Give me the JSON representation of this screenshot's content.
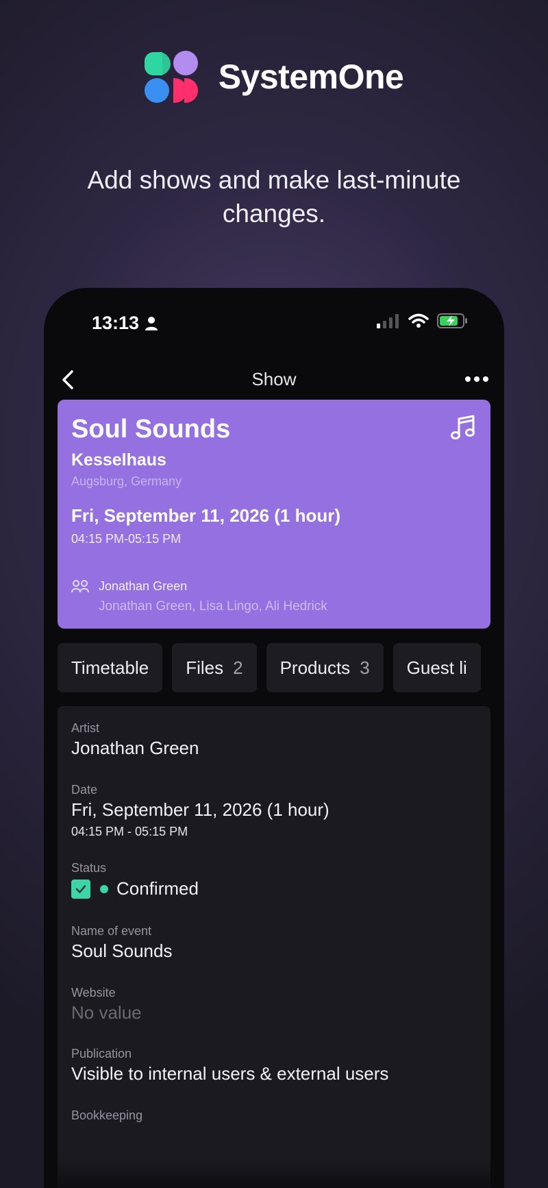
{
  "brand": {
    "name": "SystemOne"
  },
  "tagline": "Add shows and make last-minute changes.",
  "status_bar": {
    "time": "13:13"
  },
  "nav": {
    "title": "Show"
  },
  "show": {
    "title": "Soul Sounds",
    "venue": "Kesselhaus",
    "location": "Augsburg, Germany",
    "date": "Fri, September 11, 2026 (1 hour)",
    "time": "04:15 PM-05:15 PM",
    "main_artist": "Jonathan Green",
    "artists": "Jonathan Green, Lisa Lingo, Ali Hedrick"
  },
  "tabs": [
    {
      "label": "Timetable",
      "count": ""
    },
    {
      "label": "Files",
      "count": "2"
    },
    {
      "label": "Products",
      "count": "3"
    },
    {
      "label": "Guest li",
      "count": ""
    }
  ],
  "details": {
    "artist_label": "Artist",
    "artist_value": "Jonathan Green",
    "date_label": "Date",
    "date_value": "Fri, September 11, 2026 (1 hour)",
    "date_sub": "04:15 PM - 05:15 PM",
    "status_label": "Status",
    "status_value": "Confirmed",
    "event_label": "Name of event",
    "event_value": "Soul Sounds",
    "website_label": "Website",
    "website_value": "No value",
    "publication_label": "Publication",
    "publication_value": "Visible to internal users & external users",
    "bookkeeping_label": "Bookkeeping"
  },
  "colors": {
    "card": "#9470e0",
    "accent_green": "#3ed5a6",
    "logo_teal": "#2fd6a2",
    "logo_purple": "#b38cf0",
    "logo_blue": "#3a8ff2",
    "logo_pink": "#ff2f6d"
  }
}
